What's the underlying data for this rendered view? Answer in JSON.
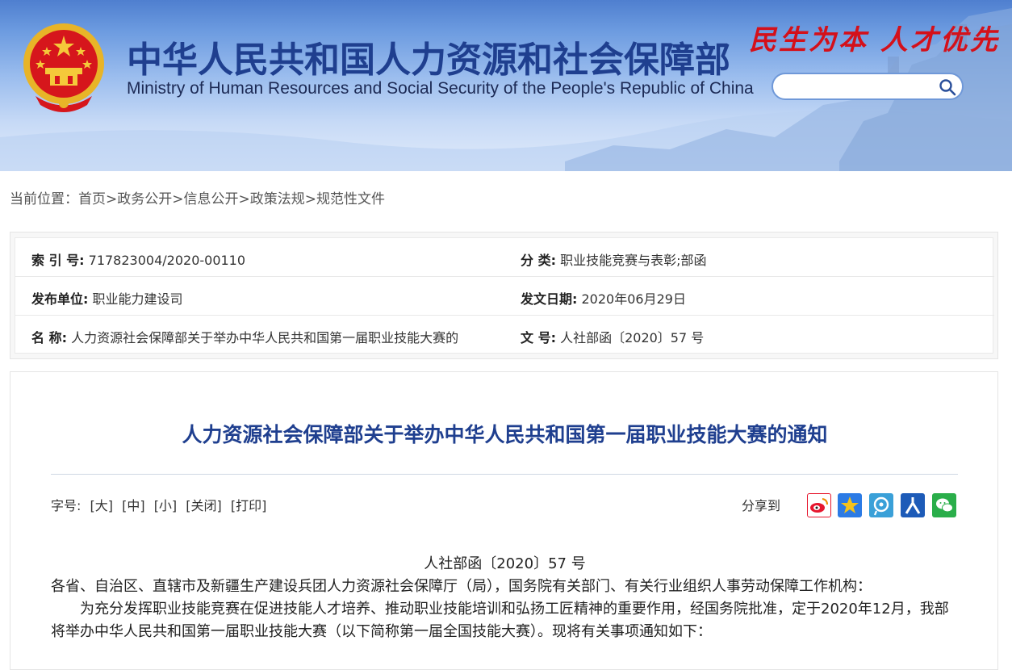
{
  "header": {
    "title": "中华人民共和国人力资源和社会保障部",
    "subtitle": "Ministry of Human Resources and Social Security of the People's Republic of China",
    "slogan": "民生为本 人才优先",
    "search_placeholder": ""
  },
  "breadcrumb": {
    "prefix": "当前位置：",
    "items": [
      "首页",
      "政务公开",
      "信息公开",
      "政策法规",
      "规范性文件"
    ],
    "sep": ">"
  },
  "meta": {
    "index_label": "索 引 号:",
    "index_value": "717823004/2020-00110",
    "category_label": "分      类:",
    "category_value": "职业技能竞赛与表彰;部函",
    "publisher_label": "发布单位:",
    "publisher_value": "职业能力建设司",
    "date_label": "发文日期:",
    "date_value": "2020年06月29日",
    "name_label": "名      称:",
    "name_value": "人力资源社会保障部关于举办中华人民共和国第一届职业技能大赛的",
    "docno_label": "文      号:",
    "docno_value": "人社部函〔2020〕57 号"
  },
  "article": {
    "title": "人力资源社会保障部关于举办中华人民共和国第一届职业技能大赛的通知",
    "font_label": "字号:",
    "font_large": "[大]",
    "font_medium": "[中]",
    "font_small": "[小]",
    "close": "[关闭]",
    "print": "[打印]",
    "share_label": "分享到",
    "doc_no": "人社部函〔2020〕57 号",
    "recipients": "各省、自治区、直辖市及新疆生产建设兵团人力资源社会保障厅（局），国务院有关部门、有关行业组织人事劳动保障工作机构：",
    "para1": "为充分发挥职业技能竞赛在促进技能人才培养、推动职业技能培训和弘扬工匠精神的重要作用，经国务院批准，定于2020年12月，我部将举办中华人民共和国第一届职业技能大赛（以下简称第一届全国技能大赛）。现将有关事项通知如下："
  },
  "colors": {
    "title_blue": "#1f3f8f",
    "slogan_red": "#d4101a",
    "weibo": "#e6162d",
    "qzone": "#2c7be5",
    "tencent_weibo": "#3aa0d8",
    "renren": "#1d5bb8",
    "wechat": "#2aae4a"
  }
}
